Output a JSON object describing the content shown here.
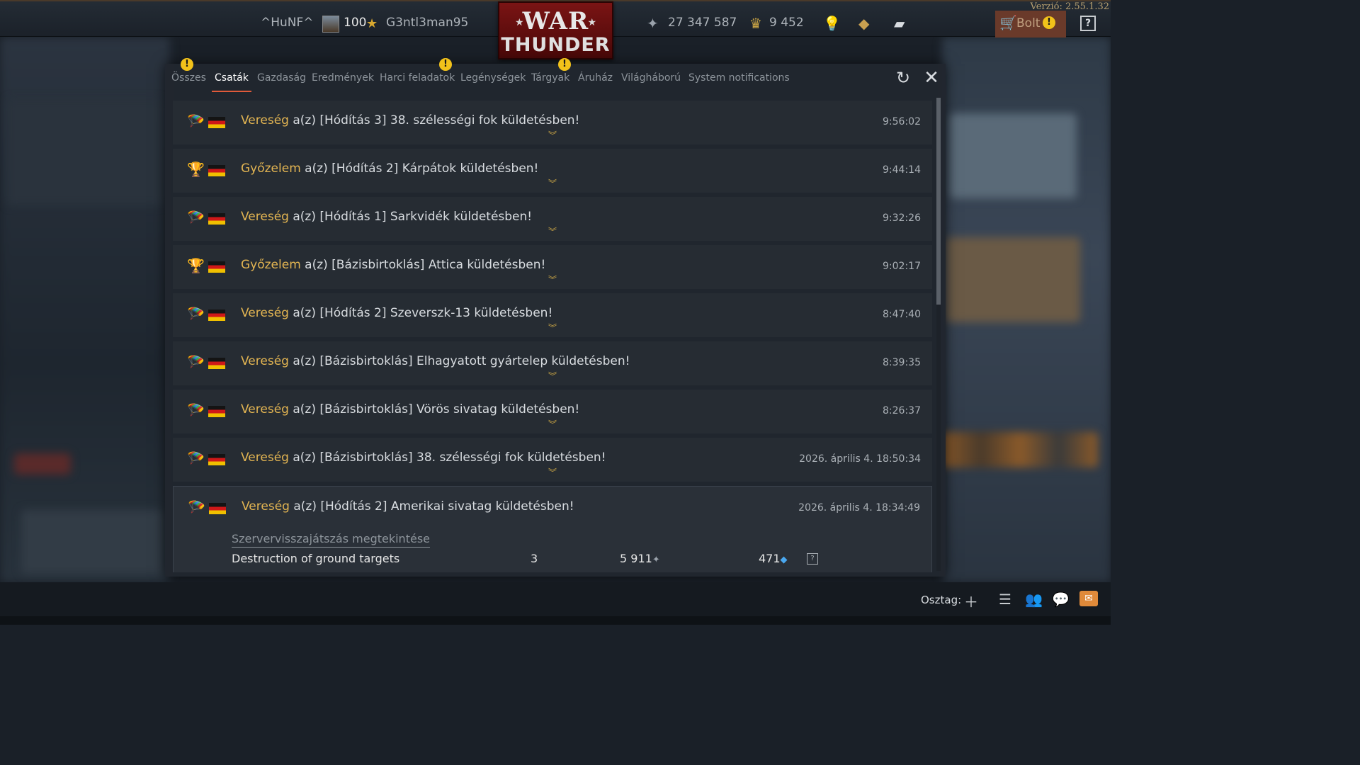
{
  "app": {
    "version": "Verzió: 2.55.1.32",
    "logo_line1": "WAR",
    "logo_line2": "THUNDER"
  },
  "topbar": {
    "clan": "^HuNF^",
    "rank": "100",
    "nickname": "G3ntl3man95",
    "silver_lions": "27 347 587",
    "golden_eagles": "9 452",
    "shop_label": "Bolt",
    "help_label": "?",
    "icons": [
      "avatar-icon",
      "rank-star-icon",
      "silver-lions-icon",
      "golden-eagles-icon",
      "lightbulb-icon",
      "diamond-icon",
      "coupon-icon",
      "cart-icon",
      "warning-icon",
      "help-icon"
    ]
  },
  "tabs": [
    {
      "label": "Összes",
      "warning": true
    },
    {
      "label": "Csaták",
      "active": true
    },
    {
      "label": "Gazdaság"
    },
    {
      "label": "Eredmények"
    },
    {
      "label": "Harci feladatok",
      "warning": true
    },
    {
      "label": "Legénységek"
    },
    {
      "label": "Tárgyak",
      "warning": true
    },
    {
      "label": "Áruház"
    },
    {
      "label": "Világháború"
    },
    {
      "label": "System notifications"
    }
  ],
  "notifications": [
    {
      "result": "Vereség",
      "icon": "parachute-icon",
      "message": " a(z) [Hódítás 3] 38. szélességi fok küldetésben!",
      "time": "9:56:02"
    },
    {
      "result": "Győzelem",
      "icon": "trophy-icon",
      "message": " a(z) [Hódítás 2] Kárpátok küldetésben!",
      "time": "9:44:14"
    },
    {
      "result": "Vereség",
      "icon": "parachute-icon",
      "message": " a(z) [Hódítás 1] Sarkvidék küldetésben!",
      "time": "9:32:26"
    },
    {
      "result": "Győzelem",
      "icon": "trophy-icon",
      "message": " a(z) [Bázisbirtoklás] Attica küldetésben!",
      "time": "9:02:17"
    },
    {
      "result": "Vereség",
      "icon": "parachute-icon",
      "message": " a(z) [Hódítás 2] Szeverszk-13 küldetésben!",
      "time": "8:47:40"
    },
    {
      "result": "Vereség",
      "icon": "parachute-icon",
      "message": " a(z) [Bázisbirtoklás] Elhagyatott gyártelep küldetésben!",
      "time": "8:39:35"
    },
    {
      "result": "Vereség",
      "icon": "parachute-icon",
      "message": " a(z) [Bázisbirtoklás] Vörös sivatag küldetésben!",
      "time": "8:26:37"
    },
    {
      "result": "Vereség",
      "icon": "parachute-icon",
      "message": " a(z) [Bázisbirtoklás] 38. szélességi fok küldetésben!",
      "time": "2026. április 4. 18:50:34"
    },
    {
      "result": "Vereség",
      "icon": "parachute-icon",
      "message": " a(z) [Hódítás 2] Amerikai sivatag küldetésben!",
      "time": "2026. április 4. 18:34:49",
      "expanded": true
    }
  ],
  "expanded_details": {
    "replay_link": "Szervervisszajátszás megtekintése",
    "stat_name": "Destruction of ground targets",
    "stat_count": "3",
    "stat_lions": "5 911",
    "stat_rp": "471",
    "stat_help": "?"
  },
  "bottombar": {
    "squad_label": "Osztag:",
    "icons": [
      "add-icon",
      "list-icon",
      "friends-icon",
      "chat-icon",
      "mail-icon"
    ]
  }
}
